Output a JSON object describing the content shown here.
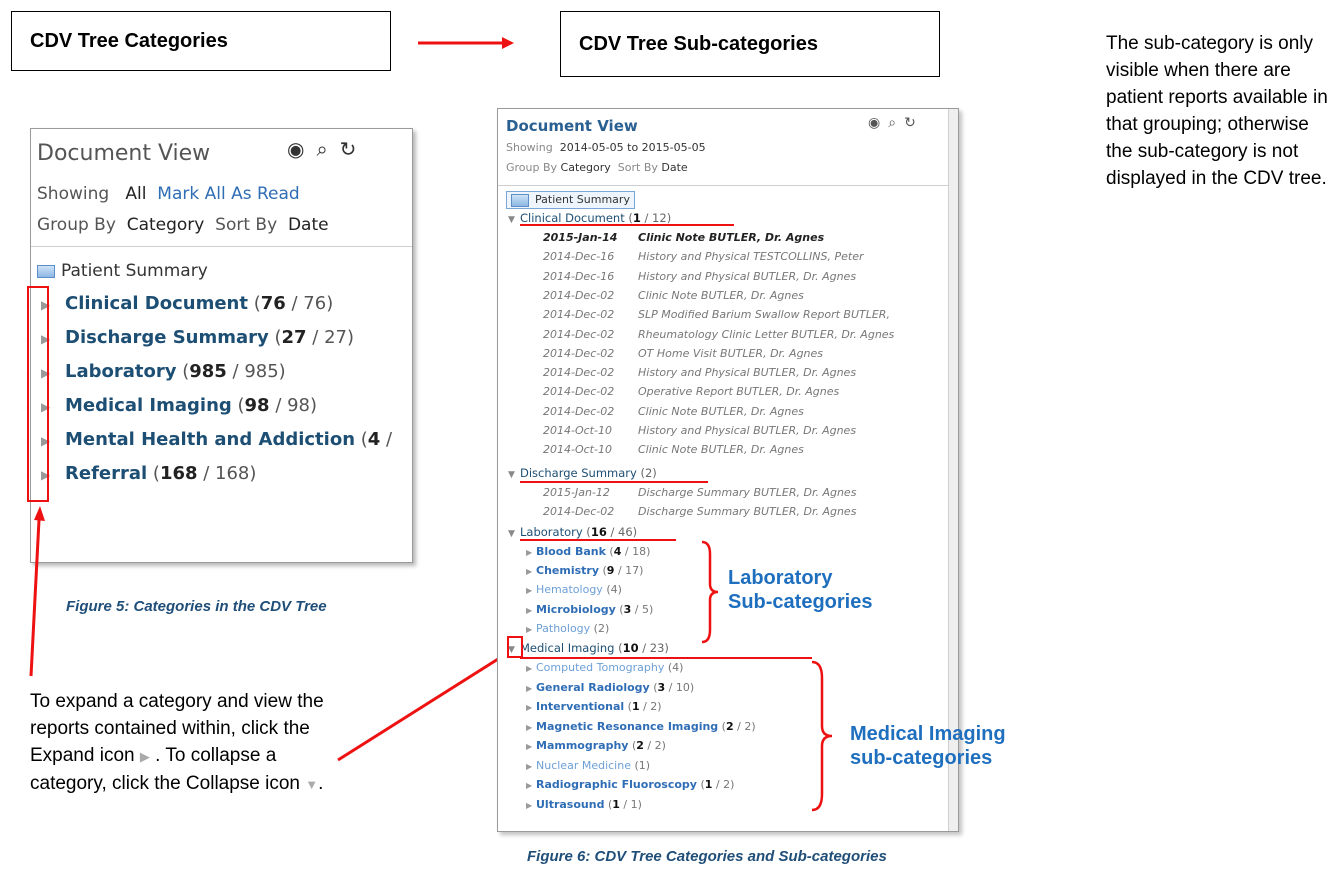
{
  "headers": {
    "left_title": "CDV Tree Categories",
    "right_title": "CDV Tree Sub-categories"
  },
  "side_note": "The sub-category is only visible when there are patient reports available in that grouping; otherwise the sub-category is not displayed in the CDV tree.",
  "figure5": {
    "caption": "Figure 5: Categories in the CDV Tree",
    "title": "Document View",
    "icons": [
      "eye-icon",
      "search-icon",
      "refresh-icon"
    ],
    "showing_label": "Showing",
    "showing_value": "All",
    "mark_all": "Mark All As Read",
    "group_by_label": "Group By",
    "group_by_value": "Category",
    "sort_by_label": "Sort By",
    "sort_by_value": "Date",
    "patient_summary": "Patient Summary",
    "categories": [
      {
        "name": "Clinical Document",
        "unread": "76",
        "total": " / 76)"
      },
      {
        "name": "Discharge Summary",
        "unread": "27",
        "total": " / 27)"
      },
      {
        "name": "Laboratory",
        "unread": "985",
        "total": " / 985)"
      },
      {
        "name": "Medical Imaging",
        "unread": "98",
        "total": " / 98)"
      },
      {
        "name": "Mental Health and Addiction",
        "unread": "4",
        "total": " /"
      },
      {
        "name": "Referral",
        "unread": "168",
        "total": " / 168)"
      }
    ]
  },
  "instruction": {
    "part1": "To expand a category and view the reports contained within, click the Expand icon",
    "part2": ". To collapse a category, click the Collapse icon",
    "part3": "."
  },
  "figure6": {
    "caption": "Figure 6: CDV Tree Categories and Sub-categories",
    "title": "Document View",
    "showing_label": "Showing",
    "showing_value": "2014-05-05 to 2015-05-05",
    "group_by_label": "Group By",
    "group_by_value": "Category",
    "sort_by_label": "Sort By",
    "sort_by_value": "Date",
    "patient_summary": "Patient Summary",
    "clinical": {
      "name": "Clinical Document",
      "unread": "1",
      "rest": " / 12)"
    },
    "clinical_docs": [
      {
        "date": "2015-Jan-14",
        "title": "Clinic Note BUTLER, Dr. Agnes"
      },
      {
        "date": "2014-Dec-16",
        "title": "History and Physical TESTCOLLINS, Peter"
      },
      {
        "date": "2014-Dec-16",
        "title": "History and Physical BUTLER, Dr. Agnes"
      },
      {
        "date": "2014-Dec-02",
        "title": "Clinic Note BUTLER, Dr. Agnes"
      },
      {
        "date": "2014-Dec-02",
        "title": "SLP Modified Barium Swallow Report BUTLER,"
      },
      {
        "date": "2014-Dec-02",
        "title": "Rheumatology Clinic Letter BUTLER, Dr. Agnes"
      },
      {
        "date": "2014-Dec-02",
        "title": "OT Home Visit BUTLER, Dr. Agnes"
      },
      {
        "date": "2014-Dec-02",
        "title": "History and Physical BUTLER, Dr. Agnes"
      },
      {
        "date": "2014-Dec-02",
        "title": "Operative Report BUTLER, Dr. Agnes"
      },
      {
        "date": "2014-Dec-02",
        "title": "Clinic Note BUTLER, Dr. Agnes"
      },
      {
        "date": "2014-Oct-10",
        "title": "History and Physical BUTLER, Dr. Agnes"
      },
      {
        "date": "2014-Oct-10",
        "title": "Clinic Note BUTLER, Dr. Agnes"
      }
    ],
    "discharge": {
      "name": "Discharge Summary",
      "rest": " (2)"
    },
    "discharge_docs": [
      {
        "date": "2015-Jan-12",
        "title": "Discharge Summary BUTLER, Dr. Agnes"
      },
      {
        "date": "2014-Dec-02",
        "title": "Discharge Summary BUTLER, Dr. Agnes"
      }
    ],
    "laboratory": {
      "name": "Laboratory",
      "unread": "16",
      "rest": " / 46)"
    },
    "lab_subs": [
      {
        "name": "Blood Bank",
        "unread": "4",
        "rest": " / 18)",
        "light": false
      },
      {
        "name": "Chemistry",
        "unread": "9",
        "rest": " / 17)",
        "light": false
      },
      {
        "name": "Hematology",
        "unread": "",
        "rest": " (4)",
        "light": true
      },
      {
        "name": "Microbiology",
        "unread": "3",
        "rest": " / 5)",
        "light": false
      },
      {
        "name": "Pathology",
        "unread": "",
        "rest": " (2)",
        "light": true
      }
    ],
    "imaging": {
      "name": "Medical Imaging",
      "unread": "10",
      "rest": " / 23)"
    },
    "img_subs": [
      {
        "name": "Computed Tomography",
        "unread": "",
        "rest": " (4)",
        "light": true
      },
      {
        "name": "General Radiology",
        "unread": "3",
        "rest": " / 10)",
        "light": false
      },
      {
        "name": "Interventional",
        "unread": "1",
        "rest": " / 2)",
        "light": false
      },
      {
        "name": "Magnetic Resonance Imaging",
        "unread": "2",
        "rest": " / 2)",
        "light": false
      },
      {
        "name": "Mammography",
        "unread": "2",
        "rest": " / 2)",
        "light": false
      },
      {
        "name": "Nuclear Medicine",
        "unread": "",
        "rest": " (1)",
        "light": true
      },
      {
        "name": "Radiographic Fluoroscopy",
        "unread": "1",
        "rest": " / 2)",
        "light": false
      },
      {
        "name": "Ultrasound",
        "unread": "1",
        "rest": " / 1)",
        "light": false
      }
    ],
    "lab_label_1": "Laboratory",
    "lab_label_2": "Sub-categories",
    "img_label_1": "Medical Imaging",
    "img_label_2": "sub-categories"
  },
  "colors": {
    "annotation_red": "#e11111",
    "link_blue": "#2f6db5",
    "heading_blue": "#1d4e73"
  }
}
